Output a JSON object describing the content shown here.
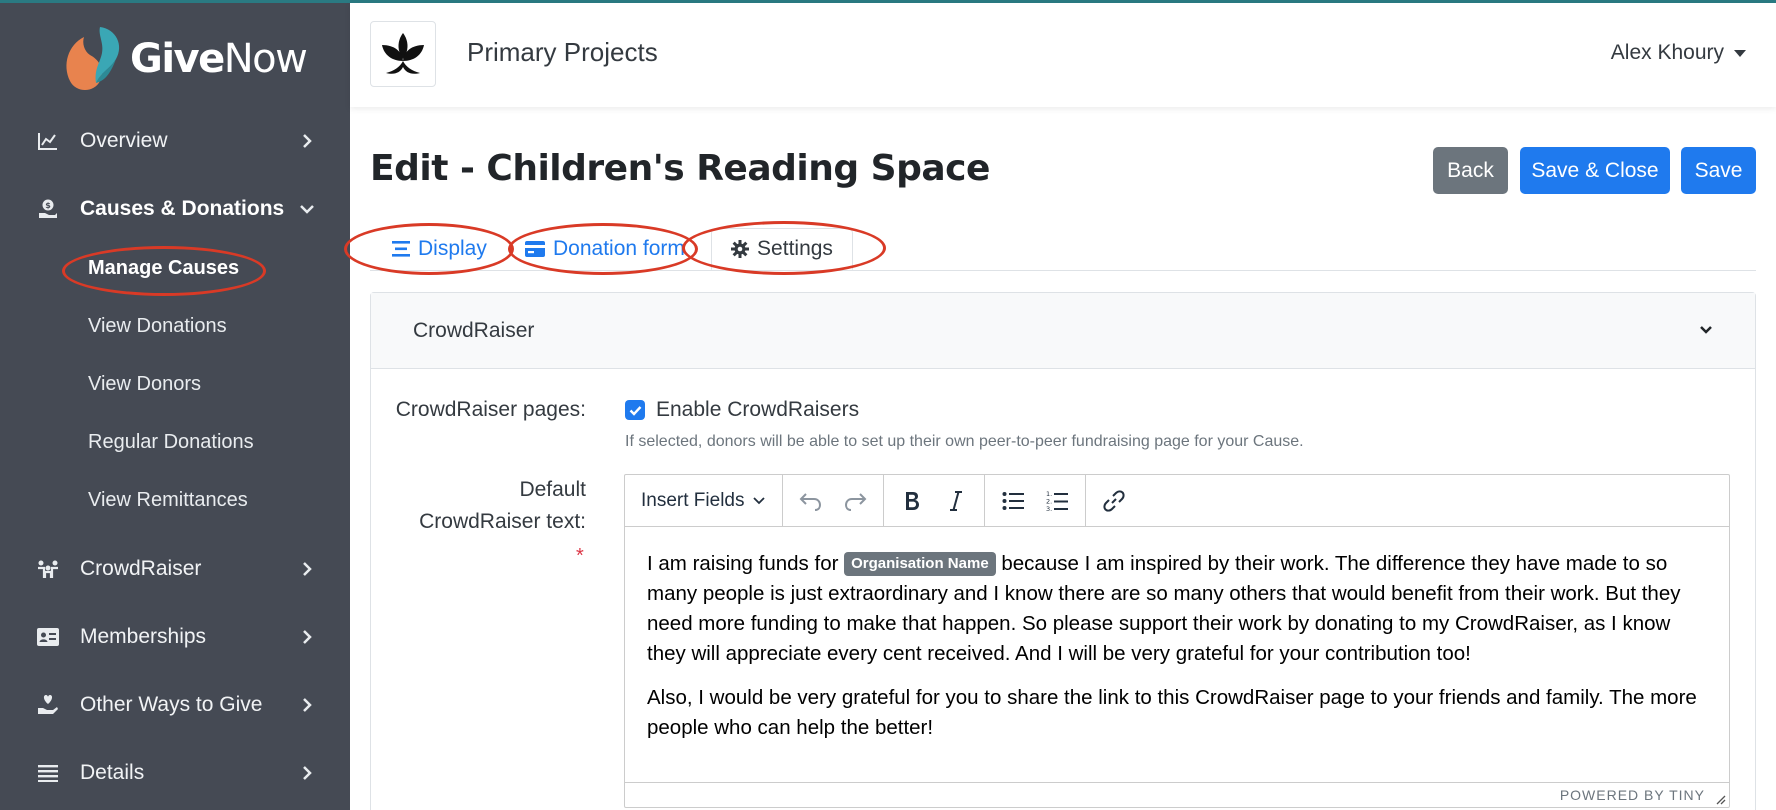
{
  "app": {
    "name_bold": "Give",
    "name_light": "Now"
  },
  "colors": {
    "sidebar": "#454a54",
    "primary": "#1f7aee",
    "secondary": "#6c757d",
    "annotation": "#d93a26"
  },
  "sidebar": {
    "items": [
      {
        "label": "Overview",
        "icon": "line-chart-icon"
      },
      {
        "label": "Causes & Donations",
        "icon": "donation-hand-icon",
        "expanded": true,
        "children": [
          "Manage Causes",
          "View Donations",
          "View Donors",
          "Regular Donations",
          "View Remittances"
        ]
      },
      {
        "label": "CrowdRaiser",
        "icon": "people-group-icon"
      },
      {
        "label": "Memberships",
        "icon": "id-card-icon"
      },
      {
        "label": "Other Ways to Give",
        "icon": "hand-heart-icon"
      },
      {
        "label": "Details",
        "icon": "list-icon"
      }
    ]
  },
  "header": {
    "org_name": "Primary Projects",
    "user_name": "Alex Khoury"
  },
  "page": {
    "title": "Edit - Children's Reading Space",
    "buttons": {
      "back": "Back",
      "save_close": "Save & Close",
      "save": "Save"
    },
    "tabs": [
      {
        "label": "Display",
        "icon": "align-icon"
      },
      {
        "label": "Donation form",
        "icon": "credit-card-icon"
      },
      {
        "label": "Settings",
        "icon": "gear-icon",
        "active": true
      }
    ]
  },
  "section": {
    "title": "CrowdRaiser",
    "pages_label": "CrowdRaiser pages:",
    "enable_label": "Enable CrowdRaisers",
    "enable_checked": true,
    "help": "If selected, donors will be able to set up their own peer-to-peer fundraising page for your Cause.",
    "text_label_1": "Default",
    "text_label_2": "CrowdRaiser text:",
    "required_mark": "*"
  },
  "editor": {
    "insert_fields": "Insert Fields",
    "para1_before": "I am raising funds for ",
    "merge_tag": "Organisation Name",
    "para1_after": " because I am inspired by their work. The difference they have made to so many people is just extraordinary and I know there are so many others that would benefit from their work. But they need more funding to make that happen. So please support their work by donating to my CrowdRaiser, as I know they will appreciate every cent received. And I will be very grateful for your contribution too!",
    "para2": "Also, I would be very grateful for you to share the link to this CrowdRaiser page to your friends and family. The more people who can help the better!",
    "powered_by": "POWERED BY TINY"
  }
}
